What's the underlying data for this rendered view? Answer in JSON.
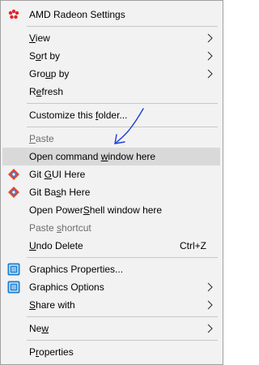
{
  "menu": {
    "header": {
      "label": "AMD Radeon Settings",
      "icon": "amd-radeon-icon",
      "color": "#e4212b"
    },
    "items": [
      {
        "pre": "",
        "key": "V",
        "post": "iew",
        "submenu": true
      },
      {
        "pre": "S",
        "key": "o",
        "post": "rt by",
        "submenu": true
      },
      {
        "pre": "Gro",
        "key": "u",
        "post": "p by",
        "submenu": true
      },
      {
        "pre": "R",
        "key": "e",
        "post": "fresh"
      },
      {
        "pre": "Customize this ",
        "key": "f",
        "post": "older..."
      },
      {
        "pre": "",
        "key": "P",
        "post": "aste",
        "disabled": true
      },
      {
        "pre": "Open command ",
        "key": "w",
        "post": "indow here",
        "highlighted": true
      },
      {
        "pre": "Git ",
        "key": "G",
        "post": "UI Here",
        "icon": "git-icon"
      },
      {
        "pre": "Git Ba",
        "key": "s",
        "post": "h Here",
        "icon": "git-icon"
      },
      {
        "pre": "Open Power",
        "key": "S",
        "post": "hell window here"
      },
      {
        "pre": "Paste ",
        "key": "s",
        "post": "hortcut",
        "disabled": true
      },
      {
        "pre": "",
        "key": "U",
        "post": "ndo Delete",
        "shortcut": "Ctrl+Z"
      },
      {
        "pre": "Graphics Properties...",
        "key": "",
        "post": "",
        "icon": "intel-graphics-icon"
      },
      {
        "pre": "Graphics Options",
        "key": "",
        "post": "",
        "icon": "intel-graphics-icon",
        "submenu": true
      },
      {
        "pre": "",
        "key": "S",
        "post": "hare with",
        "submenu": true
      },
      {
        "pre": "Ne",
        "key": "w",
        "post": "",
        "submenu": true
      },
      {
        "pre": "P",
        "key": "r",
        "post": "operties"
      }
    ]
  },
  "annotation": {
    "icon": "pen-arrow-icon",
    "color": "#1f3fd6"
  },
  "colors": {
    "menu_bg": "#f2f2f2",
    "highlight": "#d9d9d9",
    "separator": "#c8c8c8",
    "disabled_text": "#6d6d6d"
  }
}
